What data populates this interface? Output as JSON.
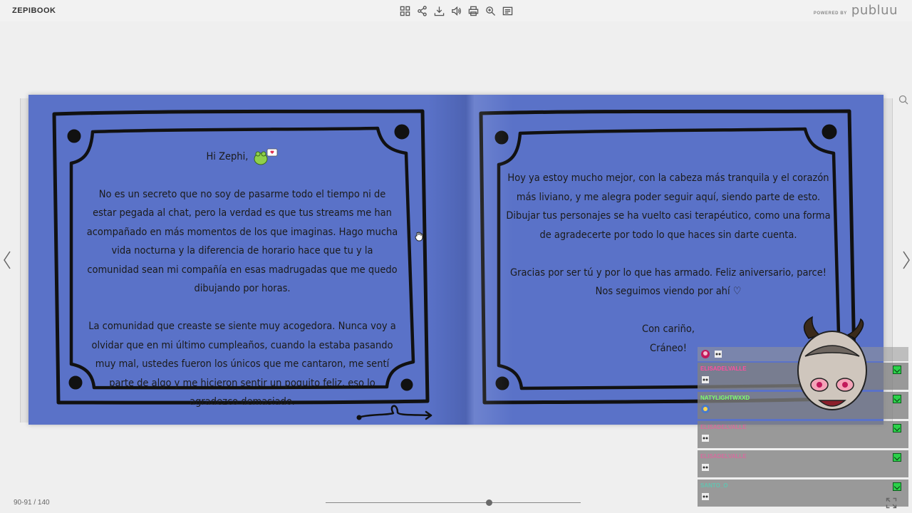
{
  "app": {
    "title": "ZEPIBOOK"
  },
  "toolbar": {
    "buttons": [
      {
        "name": "thumbnails-icon"
      },
      {
        "name": "share-icon"
      },
      {
        "name": "download-icon"
      },
      {
        "name": "sound-icon"
      },
      {
        "name": "print-icon"
      },
      {
        "name": "zoom-icon"
      },
      {
        "name": "fullscreen-text-icon"
      }
    ]
  },
  "powered": {
    "label": "POWERED BY",
    "brand": "publuu"
  },
  "left_page": {
    "greeting": "Hi Zephi,",
    "p1": "No es un secreto que no soy de pasarme todo el tiempo ni de estar pegada al chat, pero la verdad es que tus streams me han acompañado en más momentos de los que imaginas. Hago mucha vida nocturna y la diferencia de horario hace que tu y la comunidad sean mi compañía en esas madrugadas que me quedo dibujando por horas.",
    "p2": "La comunidad que creaste se siente muy acogedora. Nunca voy a olvidar que en mi último cumpleaños, cuando la estaba pasando muy mal, ustedes fueron los únicos que me cantaron, me sentí parte de algo y me hicieron sentir un poquito feliz, eso lo agradezco demasiado."
  },
  "right_page": {
    "p1": "Hoy ya estoy mucho mejor, con la cabeza más tranquila y el corazón más liviano, y me alegra poder seguir aquí, siendo parte de esto. Dibujar tus personajes se ha vuelto casi terapéutico, como una forma de agradecerte por todo lo que haces sin darte cuenta.",
    "p2a": "Gracias por ser tú y por lo que has armado. Feliz aniversario, parce!",
    "p2b": "Nos seguimos viendo por ahí ♡",
    "sign1": "Con cariño,",
    "sign2": "Cráneo!"
  },
  "footer": {
    "page_indicator": "90-91 / 140",
    "progress": 0.64
  },
  "chat": [
    {
      "name": "ELISADELVALLE",
      "color": "#ff4fa0"
    },
    {
      "name": "NATYLIGHTWXXD",
      "color": "#7cff6b"
    },
    {
      "name": "ELISADELVALLE",
      "color": "#ff4fa0"
    },
    {
      "name": "ELISADELVALLE",
      "color": "#ff4fa0"
    },
    {
      "name": "SANTO_O",
      "color": "#40e0c0"
    }
  ],
  "colors": {
    "page": "#5a72c8",
    "frame": "#111111",
    "background": "#efefef"
  }
}
